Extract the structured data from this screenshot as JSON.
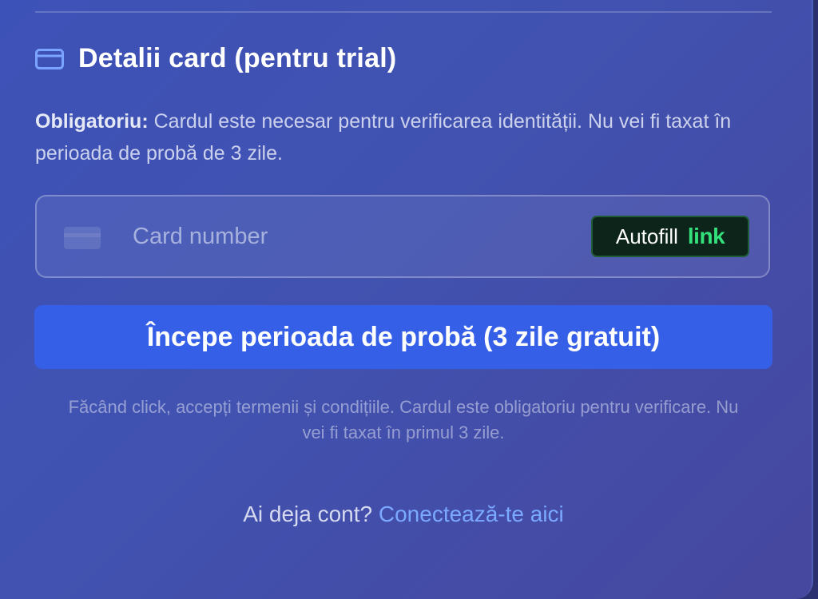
{
  "section": {
    "title": "Detalii card (pentru trial)",
    "icon": "credit-card-icon",
    "accent": "#7aa4ff"
  },
  "notice": {
    "label": "Obligatoriu:",
    "text": "Cardul este necesar pentru verificarea identității. Nu vei fi taxat în perioada de probă de 3 zile."
  },
  "card_input": {
    "placeholder": "Card number",
    "brand_icon": "generic-card-icon",
    "autofill_label": "Autofill",
    "autofill_brand": "link",
    "autofill_brand_color": "#34e07c"
  },
  "primary_button": {
    "label": "Începe perioada de probă (3 zile gratuit)",
    "color": "#365fe8"
  },
  "disclaimer": {
    "text": "Făcând click, accepți termenii și condițiile. Cardul este obligatoriu pentru verificare. Nu vei fi taxat în primul 3 zile."
  },
  "login": {
    "prompt": "Ai deja cont?",
    "link": "Conectează-te aici",
    "link_color": "#7ba9ff"
  }
}
